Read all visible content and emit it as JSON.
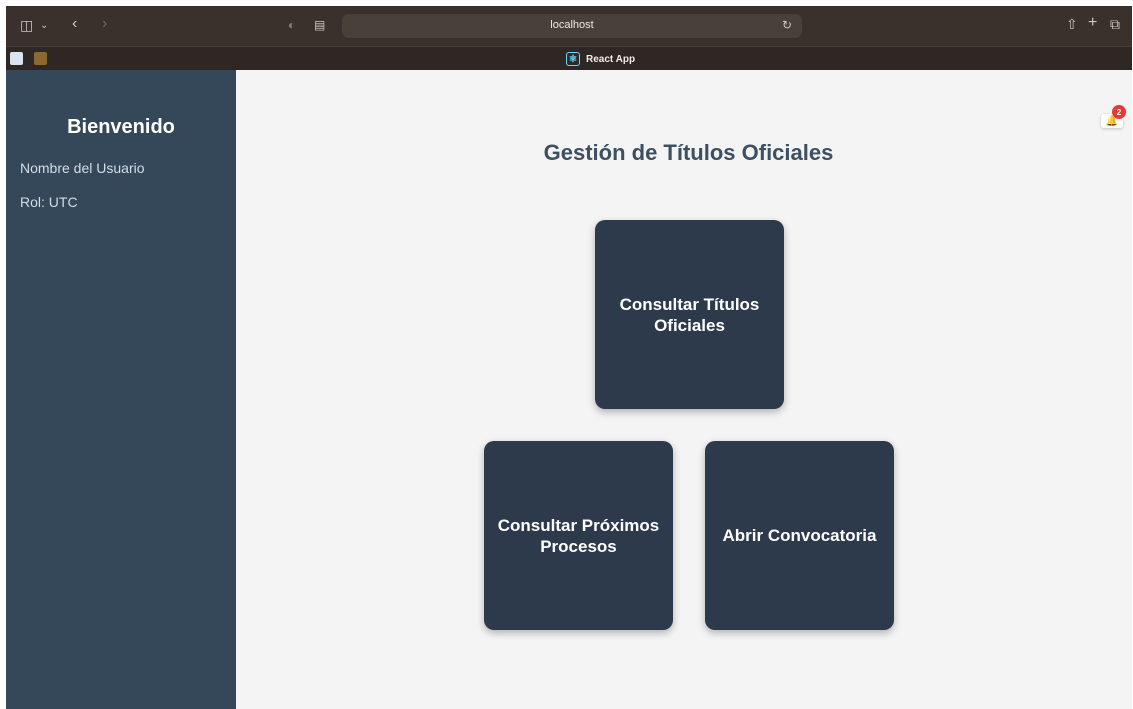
{
  "browser": {
    "url": "localhost",
    "tab_title": "React App",
    "icons": [
      "sidebar-toggle-icon",
      "chevron-down-icon",
      "back-icon",
      "forward-icon",
      "privacy-icon",
      "tab-overview-icon",
      "reload-icon",
      "share-icon",
      "new-tab-icon",
      "tabs-icon",
      "react-icon",
      "bookmark-favicon-icon"
    ]
  },
  "sidebar": {
    "welcome": "Bienvenido",
    "user_name": "Nombre del Usuario",
    "role": "Rol: UTC"
  },
  "main": {
    "title": "Gestión de Títulos Oficiales",
    "cards": [
      {
        "label": "Consultar Títulos Oficiales"
      },
      {
        "label": "Consultar Próximos Procesos"
      },
      {
        "label": "Abrir Convocatoria"
      }
    ],
    "notifications": {
      "count": "2",
      "icon": "bell-icon"
    }
  },
  "colors": {
    "sidebar_bg": "#34485a",
    "main_bg": "#f4f4f4",
    "card_bg": "#2d3a4b",
    "title_text": "#3d4f60",
    "badge": "#e53935",
    "chrome_bg": "#3b312c"
  }
}
